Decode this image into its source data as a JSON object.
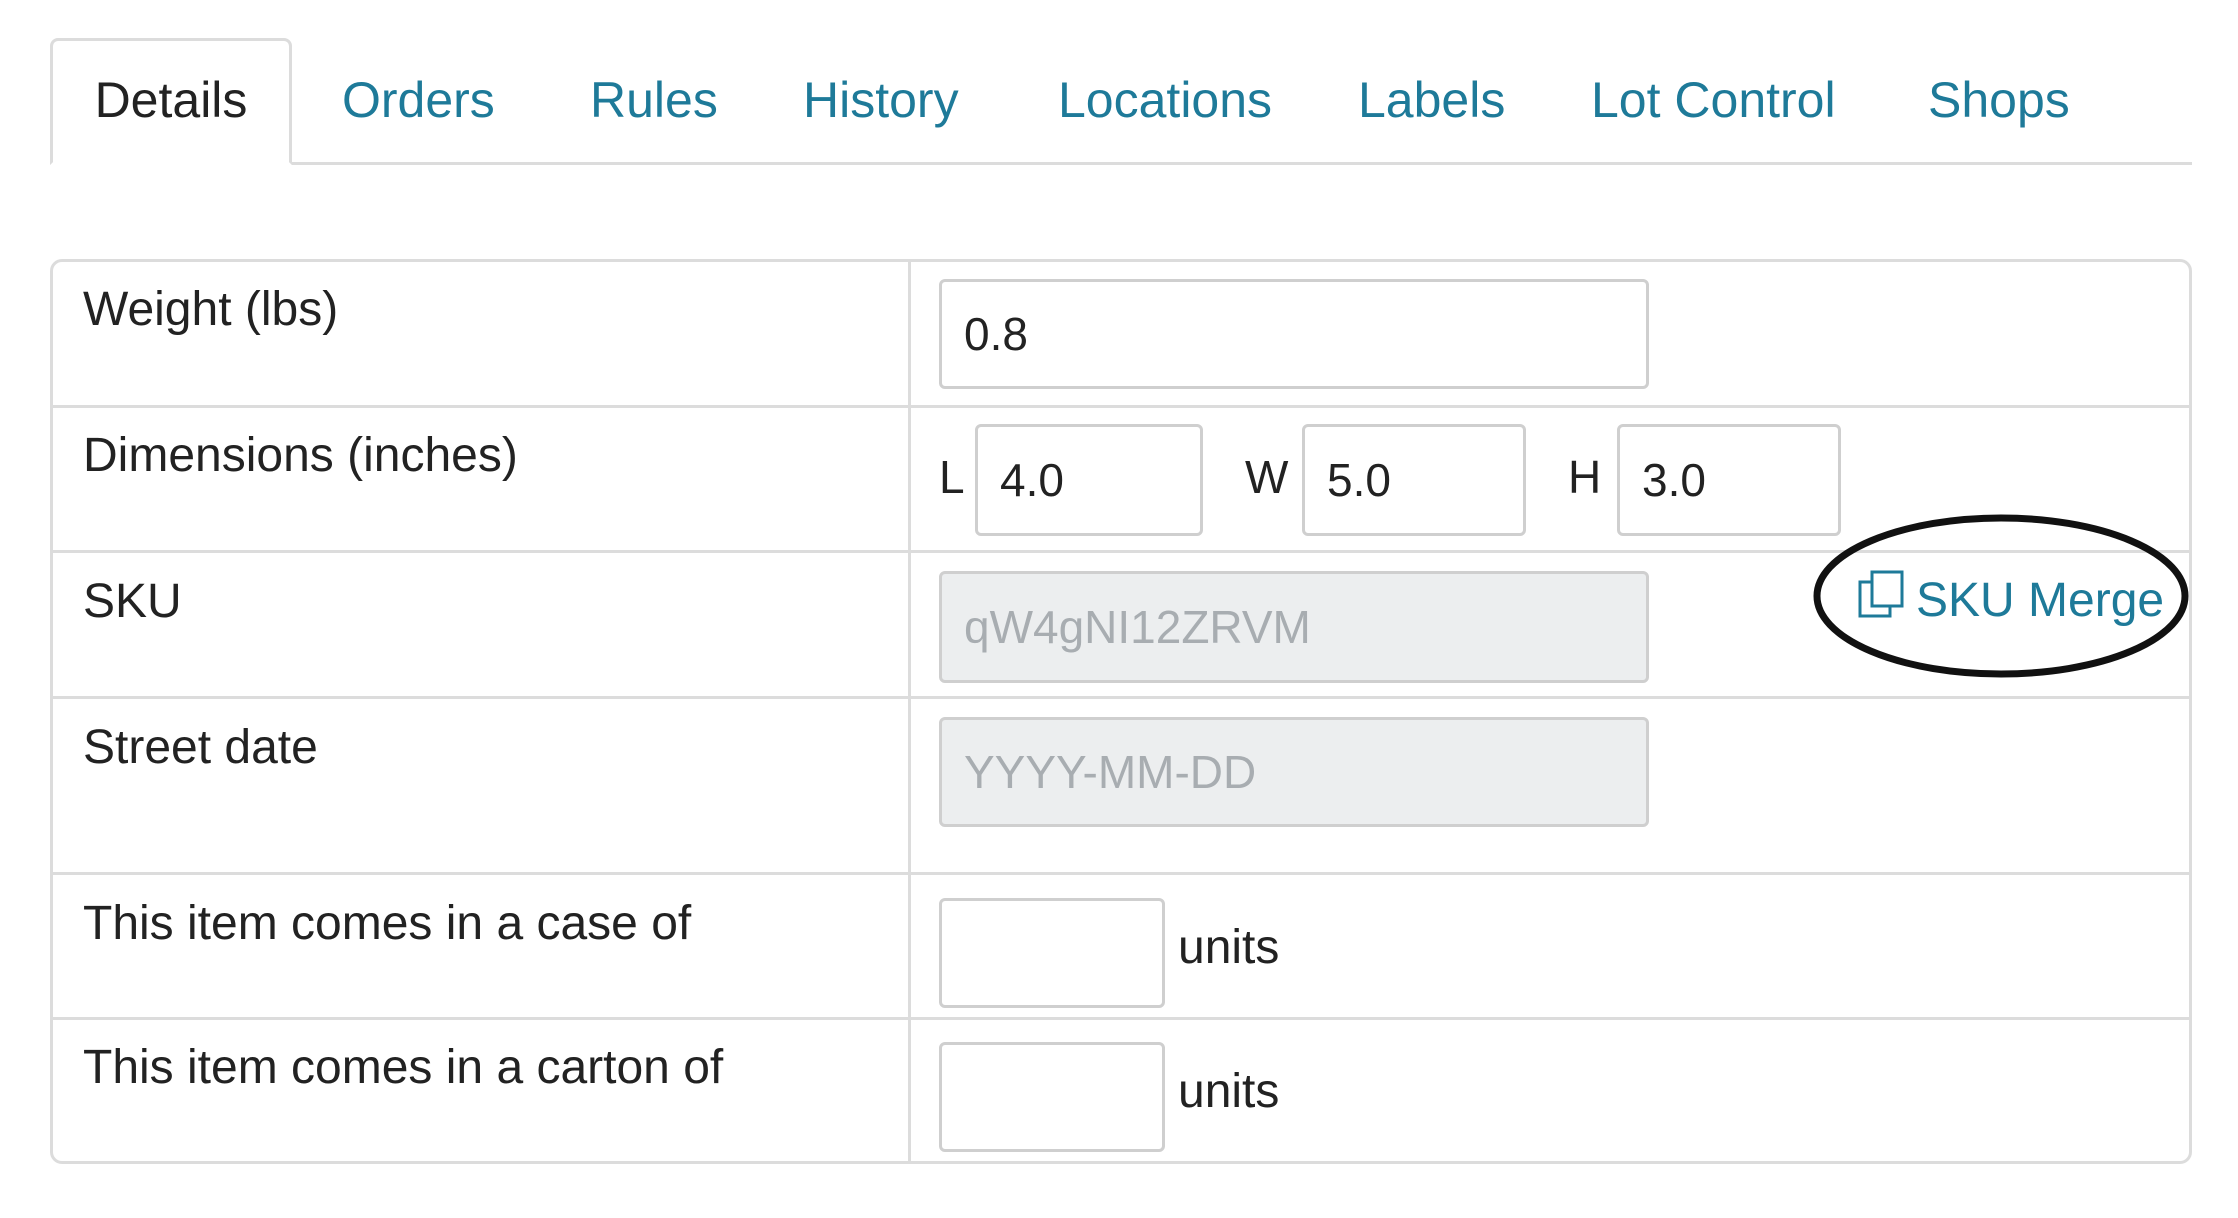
{
  "tabs": [
    {
      "label": "Details",
      "active": true
    },
    {
      "label": "Orders"
    },
    {
      "label": "Rules"
    },
    {
      "label": "History"
    },
    {
      "label": "Locations"
    },
    {
      "label": "Labels"
    },
    {
      "label": "Lot Control"
    },
    {
      "label": "Shops"
    }
  ],
  "fields": {
    "weight": {
      "label": "Weight (lbs)",
      "value": "0.8"
    },
    "dimensions": {
      "label": "Dimensions (inches)",
      "l_label": "L",
      "l_value": "4.0",
      "w_label": "W",
      "w_value": "5.0",
      "h_label": "H",
      "h_value": "3.0"
    },
    "sku": {
      "label": "SKU",
      "value": "qW4gNI12ZRVM"
    },
    "street_date": {
      "label": "Street date",
      "placeholder": "YYYY-MM-DD"
    },
    "case": {
      "label": "This item comes in a case of",
      "value": "",
      "units": "units"
    },
    "carton": {
      "label": "This item comes in a carton of",
      "value": "",
      "units": "units"
    }
  },
  "sku_merge": {
    "label": "SKU Merge",
    "icon": "copy-icon"
  },
  "colors": {
    "link": "#1e7a99",
    "border": "#dcdcdc",
    "disabled_bg": "#eceeef",
    "annotation": "#111111"
  }
}
